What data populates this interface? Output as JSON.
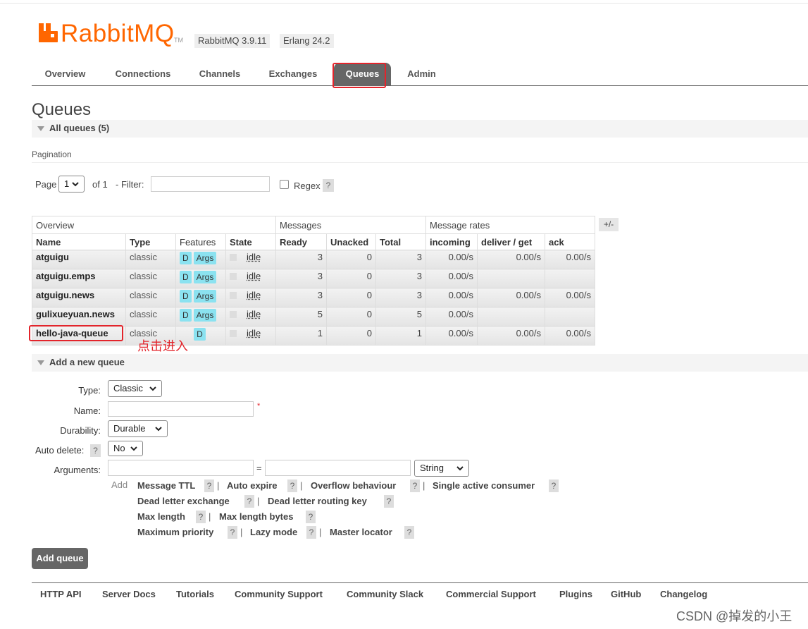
{
  "logo": {
    "name": "RabbitMQ",
    "tm": "TM"
  },
  "badges": {
    "version": "RabbitMQ 3.9.11",
    "erlang": "Erlang 24.2"
  },
  "nav": {
    "tabs": [
      "Overview",
      "Connections",
      "Channels",
      "Exchanges",
      "Queues",
      "Admin"
    ],
    "active": "Queues"
  },
  "page": {
    "title": "Queues",
    "all_queues": "All queues (5)"
  },
  "pagination": {
    "label": "Pagination",
    "page_word": "Page",
    "page_value": "1",
    "of_text": "of 1",
    "filter_label": "- Filter:",
    "filter_value": "",
    "regex_label": "Regex",
    "help": "?"
  },
  "table": {
    "groups": [
      "Overview",
      "Messages",
      "Message rates"
    ],
    "columns": [
      "Name",
      "Type",
      "Features",
      "State",
      "Ready",
      "Unacked",
      "Total",
      "incoming",
      "deliver / get",
      "ack"
    ],
    "toggle": "+/-",
    "rows": [
      {
        "name": "atguigu",
        "type": "classic",
        "features": [
          "D",
          "Args"
        ],
        "state": "idle",
        "ready": "3",
        "unacked": "0",
        "total": "3",
        "incoming": "0.00/s",
        "deliver_get": "0.00/s",
        "ack": "0.00/s"
      },
      {
        "name": "atguigu.emps",
        "type": "classic",
        "features": [
          "D",
          "Args"
        ],
        "state": "idle",
        "ready": "3",
        "unacked": "0",
        "total": "3",
        "incoming": "0.00/s",
        "deliver_get": "",
        "ack": ""
      },
      {
        "name": "atguigu.news",
        "type": "classic",
        "features": [
          "D",
          "Args"
        ],
        "state": "idle",
        "ready": "3",
        "unacked": "0",
        "total": "3",
        "incoming": "0.00/s",
        "deliver_get": "0.00/s",
        "ack": "0.00/s"
      },
      {
        "name": "gulixueyuan.news",
        "type": "classic",
        "features": [
          "D",
          "Args"
        ],
        "state": "idle",
        "ready": "5",
        "unacked": "0",
        "total": "5",
        "incoming": "0.00/s",
        "deliver_get": "",
        "ack": ""
      },
      {
        "name": "hello-java-queue",
        "type": "classic",
        "features": [
          "D"
        ],
        "state": "idle",
        "ready": "1",
        "unacked": "0",
        "total": "1",
        "incoming": "0.00/s",
        "deliver_get": "0.00/s",
        "ack": "0.00/s"
      }
    ]
  },
  "annotation": "点击进入",
  "add_queue": {
    "title": "Add a new queue",
    "type_label": "Type:",
    "type_value": "Classic",
    "name_label": "Name:",
    "required": "*",
    "durability_label": "Durability:",
    "durability_value": "Durable",
    "auto_delete_label": "Auto delete:",
    "auto_delete_value": "No",
    "arguments_label": "Arguments:",
    "equals": "=",
    "arg_type_value": "String",
    "add_label": "Add",
    "shortcut_rows": [
      [
        "Message TTL",
        "Auto expire",
        "Overflow behaviour",
        "Single active consumer"
      ],
      [
        "Dead letter exchange",
        "Dead letter routing key"
      ],
      [
        "Max length",
        "Max length bytes"
      ],
      [
        "Maximum priority",
        "Lazy mode",
        "Master locator"
      ]
    ],
    "separator": "|",
    "button": "Add queue"
  },
  "footer": {
    "links": [
      "HTTP API",
      "Server Docs",
      "Tutorials",
      "Community Support",
      "Community Slack",
      "Commercial Support",
      "Plugins",
      "GitHub",
      "Changelog"
    ]
  },
  "watermark": "CSDN @掉发的小王",
  "colors": {
    "brand": "#ff6600",
    "tab_active": "#666666",
    "feature_badge": "#8be2f0",
    "highlight": "#e3242b"
  }
}
